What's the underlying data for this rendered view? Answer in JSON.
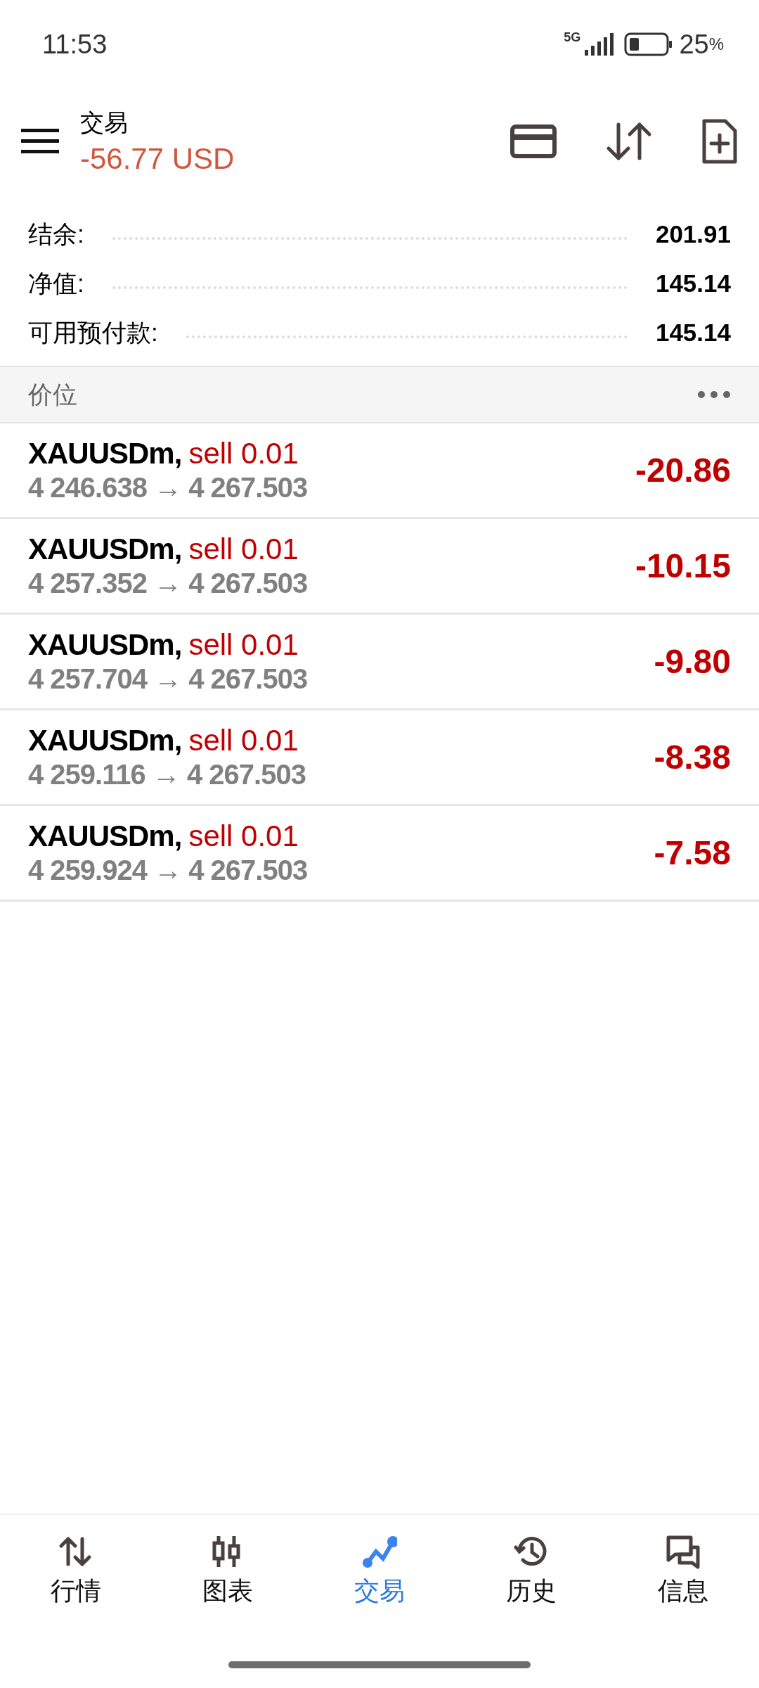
{
  "status_bar": {
    "time": "11:53",
    "network": "5G",
    "battery": "25",
    "battery_unit": "%"
  },
  "header": {
    "title": "交易",
    "profit": "-56.77 USD"
  },
  "summary": [
    {
      "label": "结余:",
      "value": "201.91"
    },
    {
      "label": "净值:",
      "value": "145.14"
    },
    {
      "label": "可用预付款:",
      "value": "145.14"
    }
  ],
  "section": {
    "title": "价位"
  },
  "positions": [
    {
      "symbol": "XAUUSDm,",
      "order": "sell 0.01",
      "prices": "4 246.638 → 4 267.503",
      "profit": "-20.86"
    },
    {
      "symbol": "XAUUSDm,",
      "order": "sell 0.01",
      "prices": "4 257.352 → 4 267.503",
      "profit": "-10.15"
    },
    {
      "symbol": "XAUUSDm,",
      "order": "sell 0.01",
      "prices": "4 257.704 → 4 267.503",
      "profit": "-9.80"
    },
    {
      "symbol": "XAUUSDm,",
      "order": "sell 0.01",
      "prices": "4 259.116 → 4 267.503",
      "profit": "-8.38"
    },
    {
      "symbol": "XAUUSDm,",
      "order": "sell 0.01",
      "prices": "4 259.924 → 4 267.503",
      "profit": "-7.58"
    }
  ],
  "nav": [
    {
      "kind": "quotes",
      "label": "行情",
      "selected": false
    },
    {
      "kind": "chart",
      "label": "图表",
      "selected": false
    },
    {
      "kind": "trade",
      "label": "交易",
      "selected": true
    },
    {
      "kind": "history",
      "label": "历史",
      "selected": false
    },
    {
      "kind": "messages",
      "label": "信息",
      "selected": false
    }
  ]
}
